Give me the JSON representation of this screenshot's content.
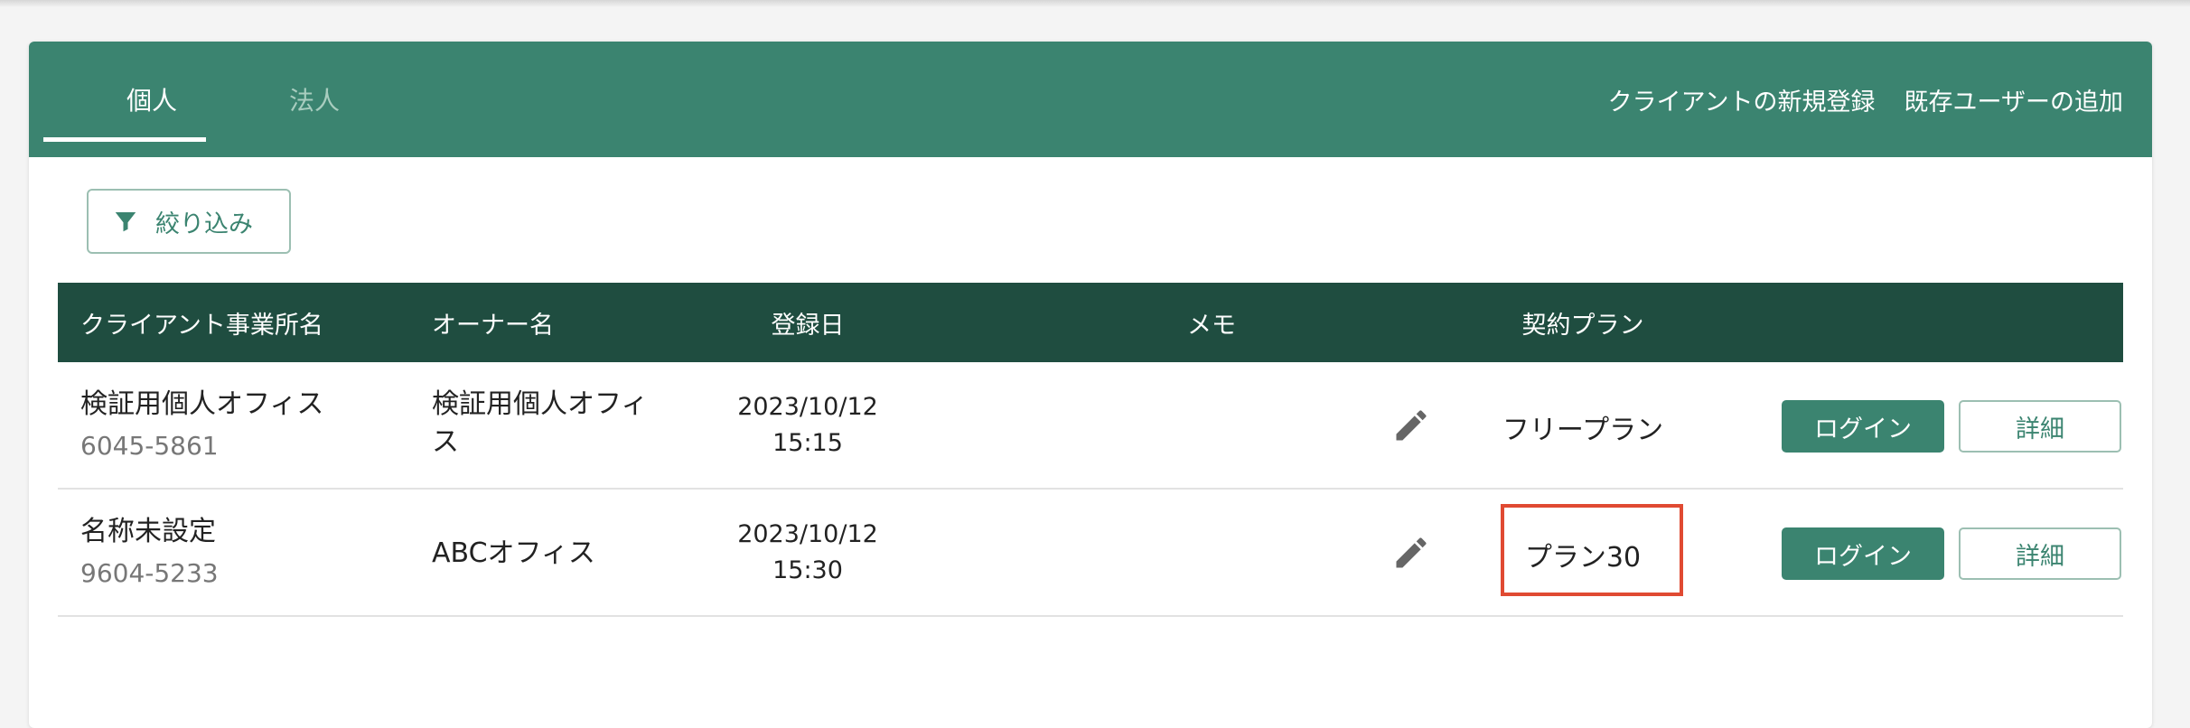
{
  "tabs": [
    {
      "label": "個人",
      "active": true
    },
    {
      "label": "法人",
      "active": false
    }
  ],
  "header_actions": {
    "new_client": "クライアントの新規登録",
    "add_existing_user": "既存ユーザーの追加"
  },
  "filter": {
    "label": "絞り込み"
  },
  "table": {
    "columns": [
      "クライアント事業所名",
      "オーナー名",
      "登録日",
      "メモ",
      "契約プラン"
    ],
    "rows": [
      {
        "name": "検証用個人オフィス",
        "code": "6045-5861",
        "owner": "検証用個人オフィス",
        "date": "2023/10/12",
        "time": "15:15",
        "plan": "フリープラン",
        "login": "ログイン",
        "detail": "詳細"
      },
      {
        "name": "名称未設定",
        "code": "9604-5233",
        "owner": "ABCオフィス",
        "date": "2023/10/12",
        "time": "15:30",
        "plan": "プラン30",
        "login": "ログイン",
        "detail": "詳細"
      }
    ]
  },
  "colors": {
    "header_green": "#3b8470",
    "table_header": "#1f4d40",
    "highlight": "#e04a32"
  },
  "icons": {
    "filter": "filter-icon",
    "edit": "pencil-icon"
  }
}
